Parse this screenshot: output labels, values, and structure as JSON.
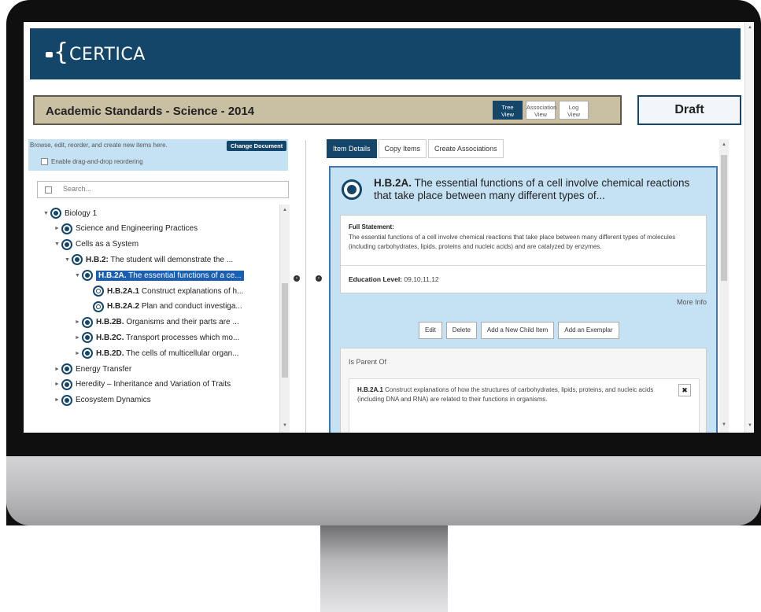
{
  "app": {
    "logo_text": "CERTICA",
    "document_title": "Academic Standards - Science - 2014",
    "status": "Draft"
  },
  "views": [
    {
      "line1": "Tree",
      "line2": "View",
      "active": true
    },
    {
      "line1": "Association",
      "line2": "View",
      "active": false
    },
    {
      "line1": "Log",
      "line2": "View",
      "active": false
    }
  ],
  "left": {
    "info_text": "Browse, edit, reorder, and create new items here.",
    "change_document": "Change Document",
    "drag_drop_label": "Enable drag-and-drop reordering",
    "search_placeholder": "Search...",
    "tree": [
      {
        "code": "",
        "text": "Biology 1",
        "depth": 0,
        "caret": "▼",
        "hollow": false,
        "selected": false
      },
      {
        "code": "",
        "text": "Science and Engineering Practices",
        "depth": 1,
        "caret": "►",
        "hollow": false,
        "selected": false
      },
      {
        "code": "",
        "text": "Cells as a System",
        "depth": 1,
        "caret": "▼",
        "hollow": false,
        "selected": false
      },
      {
        "code": "H.B.2:",
        "text": " The student will demonstrate the ...",
        "depth": 2,
        "caret": "▼",
        "hollow": false,
        "selected": false
      },
      {
        "code": "H.B.2A.",
        "text": " The essential functions of a ce...",
        "depth": 3,
        "caret": "▼",
        "hollow": false,
        "selected": true
      },
      {
        "code": "H.B.2A.1",
        "text": " Construct explanations of h...",
        "depth": 4,
        "caret": "",
        "hollow": true,
        "selected": false
      },
      {
        "code": "H.B.2A.2",
        "text": " Plan and conduct investiga...",
        "depth": 4,
        "caret": "",
        "hollow": true,
        "selected": false
      },
      {
        "code": "H.B.2B.",
        "text": " Organisms and their parts are ...",
        "depth": 3,
        "caret": "►",
        "hollow": false,
        "selected": false
      },
      {
        "code": "H.B.2C.",
        "text": " Transport processes which mo...",
        "depth": 3,
        "caret": "►",
        "hollow": false,
        "selected": false
      },
      {
        "code": "H.B.2D.",
        "text": " The cells of multicellular organ...",
        "depth": 3,
        "caret": "►",
        "hollow": false,
        "selected": false
      },
      {
        "code": "",
        "text": "Energy Transfer",
        "depth": 1,
        "caret": "►",
        "hollow": false,
        "selected": false
      },
      {
        "code": "",
        "text": "Heredity – Inheritance and Variation of Traits",
        "depth": 1,
        "caret": "►",
        "hollow": false,
        "selected": false
      },
      {
        "code": "",
        "text": "Ecosystem Dynamics",
        "depth": 1,
        "caret": "►",
        "hollow": false,
        "selected": false
      }
    ]
  },
  "right": {
    "tabs": [
      {
        "label": "Item Details",
        "active": true
      },
      {
        "label": "Copy Items",
        "active": false
      },
      {
        "label": "Create Associations",
        "active": false
      }
    ],
    "item_code": "H.B.2A.",
    "item_title": " The essential functions of a cell involve chemical reactions that take place between many different types of...",
    "full_statement_label": "Full Statement:",
    "full_statement": "The essential functions of a cell involve chemical reactions that take place between many different types of molecules (including carbohydrates, lipids, proteins and nucleic acids) and are catalyzed by enzymes.",
    "education_label": "Education Level:",
    "education_value": " 09,10,11,12",
    "more_info": "More Info",
    "actions": [
      "Edit",
      "Delete",
      "Add a New Child Item",
      "Add an Exemplar"
    ],
    "is_parent_of": "Is Parent Of",
    "child_code": "H.B.2A.1",
    "child_text": " Construct explanations of how the structures of carbohydrates, lipids, proteins, and nucleic acids (including DNA and RNA) are related to their functions in organisms.",
    "remove_symbol": "✖"
  }
}
